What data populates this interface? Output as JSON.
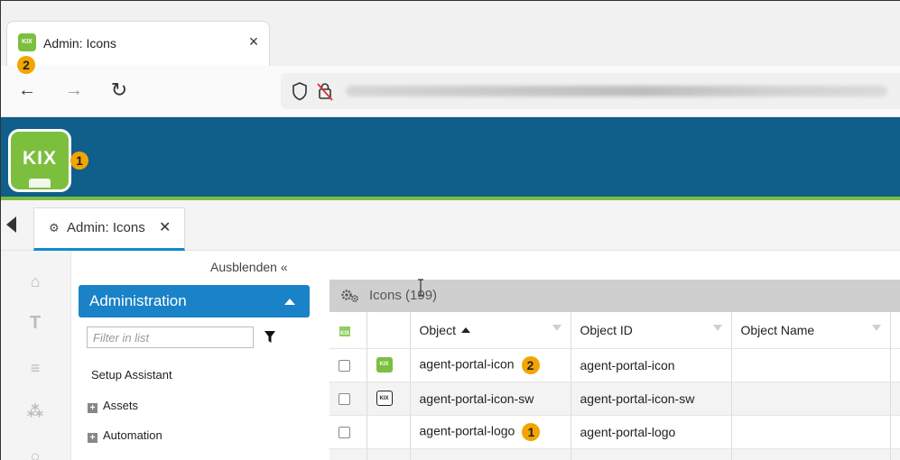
{
  "browser": {
    "tab_title": "Admin: Icons",
    "tab_close": "×",
    "favicon_text": "KIX",
    "tab_badge": "2",
    "nav": {
      "back": "←",
      "forward": "→",
      "reload": "↻"
    }
  },
  "app": {
    "logo_text": "KIX",
    "logo_badge": "1",
    "active_tab": {
      "label": "Admin: Icons",
      "close": "✕"
    }
  },
  "sidebar": {
    "hide_label": "Ausblenden «",
    "section_title": "Administration",
    "filter_placeholder": "Filter in list",
    "items": [
      {
        "label": "Setup Assistant"
      },
      {
        "label": "Assets"
      },
      {
        "label": "Automation"
      }
    ]
  },
  "panel": {
    "title": "Icons (199)"
  },
  "table": {
    "columns": [
      "Object",
      "Object ID",
      "Object Name"
    ],
    "rows": [
      {
        "object": "agent-portal-icon",
        "object_id": "agent-portal-icon",
        "object_name": "",
        "badge": "2",
        "extra": "i"
      },
      {
        "object": "agent-portal-icon-sw",
        "object_id": "agent-portal-icon-sw",
        "object_name": "",
        "badge": "",
        "extra": "i"
      },
      {
        "object": "agent-portal-logo",
        "object_id": "agent-portal-logo",
        "object_name": "",
        "badge": "1",
        "extra": "i"
      }
    ],
    "row_icon_text": "KIX"
  },
  "colors": {
    "header_blue": "#0f5f8a",
    "accent_green": "#7cbf3f",
    "primary_blue": "#1a82c6",
    "badge_orange": "#f2a500"
  }
}
